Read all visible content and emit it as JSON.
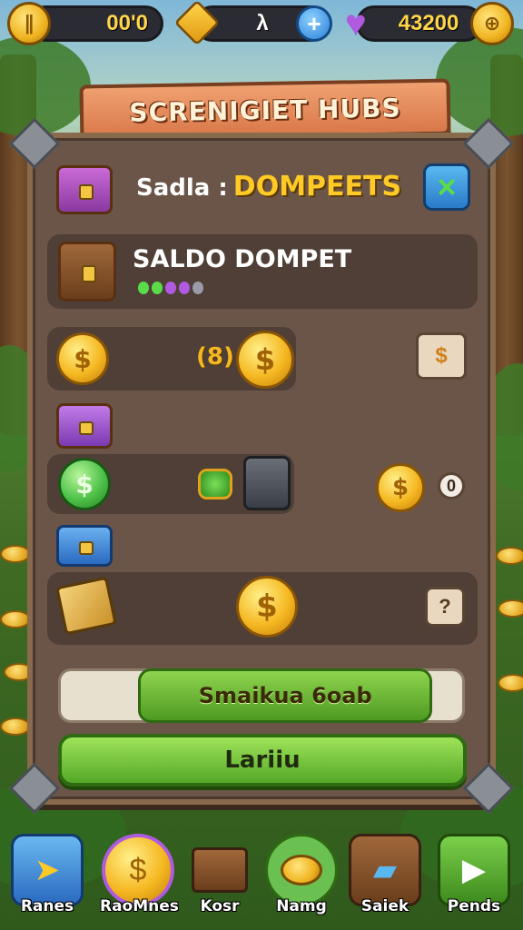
{
  "hud": {
    "left_value": "00'0",
    "gem_value": "λ",
    "gem_add": "+",
    "heart_value": "43200"
  },
  "title": "SCRENIGIET HUBS",
  "header": {
    "label_prefix": "Sadla :",
    "label_highlight": "DOMPEETS",
    "close_icon": "×"
  },
  "wallet": {
    "title": "SALDO DOMPET"
  },
  "rows": {
    "row1_amount": "(8)",
    "row1_btn": "$",
    "row3_value": "0",
    "row5_btn": "?"
  },
  "progress": {
    "label": "Smaikua 6oab",
    "fill_percent": 80
  },
  "cta_label": "Lariiu",
  "nav": [
    {
      "label": "Ranes",
      "icon": "play-arrow-icon"
    },
    {
      "label": "RaoMnes",
      "icon": "coin-icon"
    },
    {
      "label": "Kosr",
      "icon": "chest-icon"
    },
    {
      "label": "Namg",
      "icon": "coin-stack-icon"
    },
    {
      "label": "Saiek",
      "icon": "cards-icon"
    },
    {
      "label": "Pends",
      "icon": "flag-icon"
    }
  ],
  "colors": {
    "accent_gold": "#f5b822",
    "accent_green": "#55a828",
    "panel": "#6b5548"
  }
}
